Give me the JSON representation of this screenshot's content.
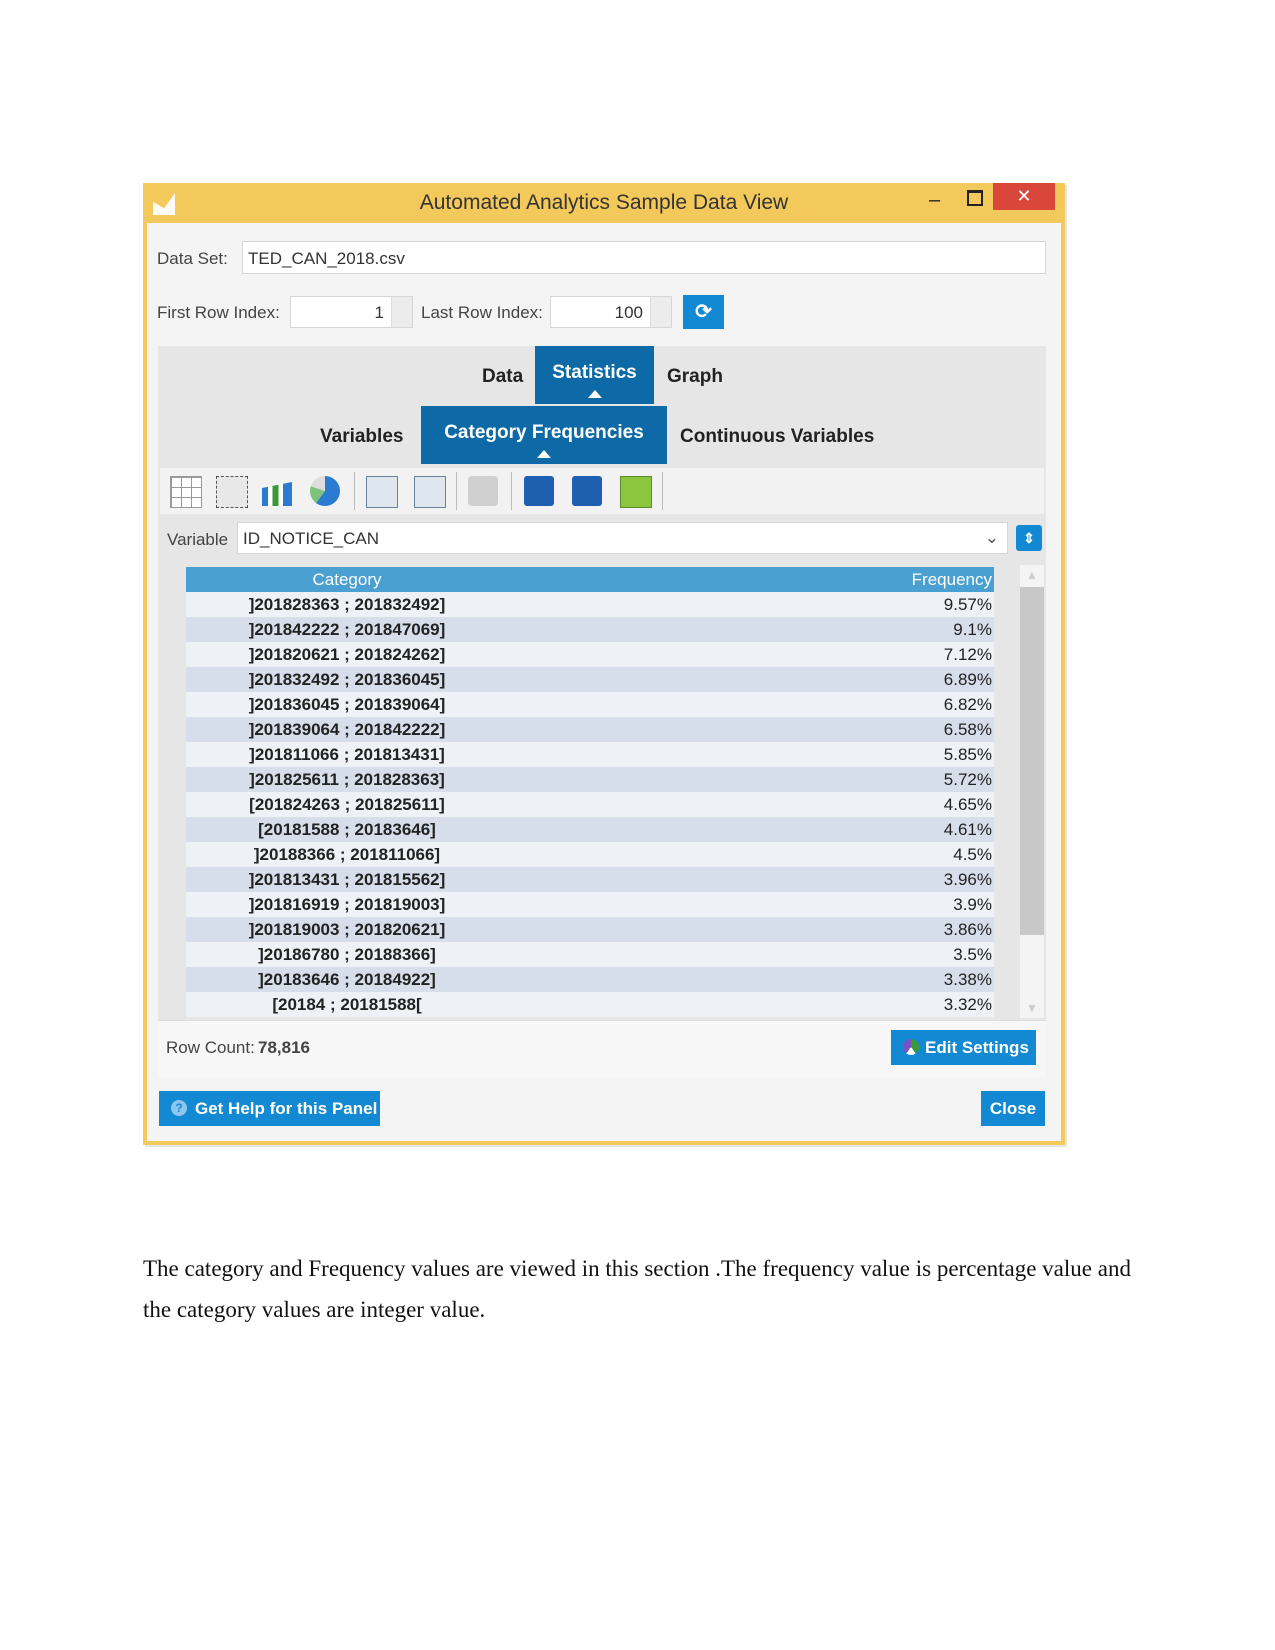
{
  "window": {
    "title": "Automated Analytics Sample Data View",
    "minimize": "–",
    "close": "✕"
  },
  "dataset": {
    "label": "Data Set:",
    "value": "TED_CAN_2018.csv"
  },
  "rows": {
    "first_label": "First Row Index:",
    "first_value": "1",
    "last_label": "Last Row Index:",
    "last_value": "100"
  },
  "tabs": [
    {
      "label": "Data"
    },
    {
      "label": "Statistics",
      "selected": true
    },
    {
      "label": "Graph"
    }
  ],
  "subtabs": [
    {
      "label": "Variables"
    },
    {
      "label": "Category Frequencies",
      "selected": true
    },
    {
      "label": "Continuous Variables"
    }
  ],
  "toolbar_icons": [
    "grid-icon",
    "report-icon",
    "bar-chart-icon",
    "pie-chart-icon",
    "copy-icon",
    "copy-add-icon",
    "print-icon",
    "save-icon",
    "save-all-icon",
    "excel-icon"
  ],
  "variable": {
    "label": "Variable",
    "value": "ID_NOTICE_CAN"
  },
  "table": {
    "headers": [
      "Category",
      "Frequency"
    ],
    "rows": [
      [
        "]201828363 ; 201832492]",
        "9.57%"
      ],
      [
        "]201842222 ; 201847069]",
        "9.1%"
      ],
      [
        "]201820621 ; 201824262]",
        "7.12%"
      ],
      [
        "]201832492 ; 201836045]",
        "6.89%"
      ],
      [
        "]201836045 ; 201839064]",
        "6.82%"
      ],
      [
        "]201839064 ; 201842222]",
        "6.58%"
      ],
      [
        "]201811066 ; 201813431]",
        "5.85%"
      ],
      [
        "]201825611 ; 201828363]",
        "5.72%"
      ],
      [
        "[201824263 ; 201825611]",
        "4.65%"
      ],
      [
        "[20181588 ; 20183646]",
        "4.61%"
      ],
      [
        "]20188366 ; 201811066]",
        "4.5%"
      ],
      [
        "]201813431 ; 201815562]",
        "3.96%"
      ],
      [
        "]201816919 ; 201819003]",
        "3.9%"
      ],
      [
        "]201819003 ; 201820621]",
        "3.86%"
      ],
      [
        "]20186780 ; 20188366]",
        "3.5%"
      ],
      [
        "]20183646 ; 20184922]",
        "3.38%"
      ],
      [
        "[20184 ; 20181588[",
        "3.32%"
      ]
    ]
  },
  "row_count": {
    "label": "Row Count:",
    "value": "78,816"
  },
  "buttons": {
    "edit_settings": "Edit Settings",
    "help": "Get Help for this Panel",
    "close": "Close"
  },
  "colors": {
    "title_bar": "#f3c95c",
    "accent": "#1289d2",
    "tab_selected": "#0e6aa6",
    "table_header": "#4aa0d0"
  },
  "paragraph": "The category and Frequency values are viewed in this section .The frequency value is percentage value and the category values are integer value."
}
